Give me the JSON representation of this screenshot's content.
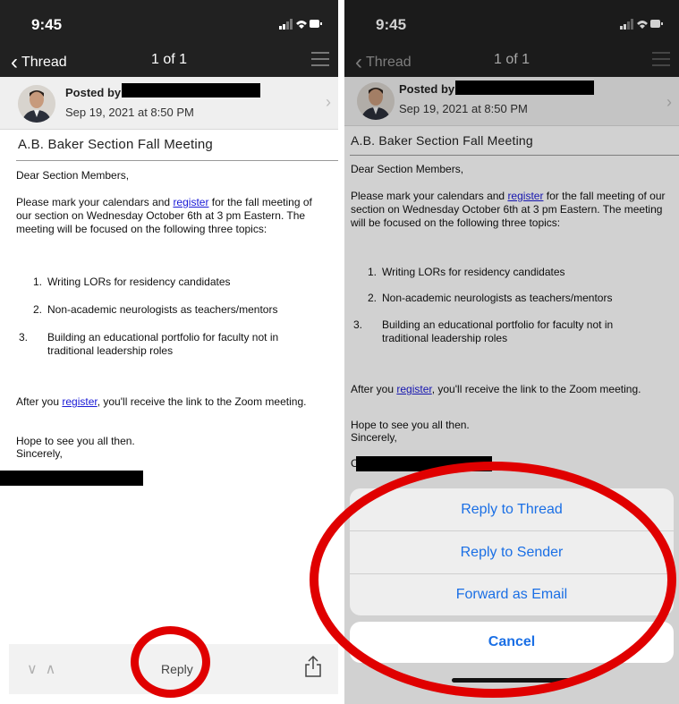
{
  "status": {
    "time": "9:45"
  },
  "nav": {
    "back_label": "Thread",
    "position": "1 of 1"
  },
  "post": {
    "posted_by_label": "Posted by",
    "date": "Sep 19, 2021 at 8:50 PM"
  },
  "message": {
    "subject": "A.B. Baker Section Fall Meeting",
    "greeting": "Dear Section Members,",
    "para1_pre": "Please mark your calendars and ",
    "link_label": "register",
    "para1_post": " for the fall meeting of our section on Wednesday October 6th at 3 pm Eastern. The meeting will be focused on the following three topics:",
    "topics": [
      {
        "num": "1.",
        "text": "Writing LORs for residency candidates"
      },
      {
        "num": "2.",
        "text": "Non-academic neurologists as teachers/mentors"
      },
      {
        "num": "3.",
        "text": "Building an educational portfolio for faculty not in traditional leadership roles"
      }
    ],
    "para2_pre": "After you ",
    "para2_post": ", you'll receive the link to the Zoom meeting.",
    "closing_1": "Hope to see you all then.",
    "closing_2": "Sincerely,",
    "sig_initial": "C"
  },
  "toolbar": {
    "reply_label": "Reply"
  },
  "action_sheet": {
    "items": [
      "Reply to Thread",
      "Reply to Sender",
      "Forward as Email"
    ],
    "cancel_label": "Cancel"
  },
  "colors": {
    "accent": "#1a6fe5",
    "annotation": "#e00000",
    "header": "#212121"
  }
}
